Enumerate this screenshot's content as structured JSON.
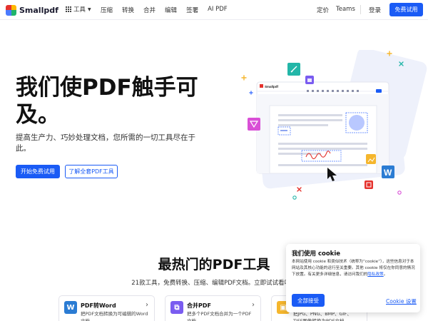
{
  "nav": {
    "brand": "Smallpdf",
    "tools_label": "工具",
    "links": [
      "压缩",
      "转换",
      "合并",
      "编辑",
      "签署",
      "AI PDF"
    ],
    "pricing": "定价",
    "teams": "Teams",
    "login": "登录",
    "cta": "免费试用"
  },
  "hero": {
    "title": "我们使PDF触手可及。",
    "subtitle": "提高生产力、巧妙处理文档，您所需的一切工具尽在于此。",
    "primary_button": "开始免费试用",
    "secondary_button": "了解全套PDF工具",
    "illustration": {
      "window_brand": "Smallpdf",
      "accent_color": "#4a7aff"
    }
  },
  "section": {
    "title": "最热门的PDF工具",
    "subtitle": "21款工具，免费转换、压缩、编辑PDF文档。立即试试看吧！",
    "cards": [
      {
        "icon": "word-icon",
        "icon_text": "W",
        "color": "#2b7cd3",
        "title": "PDF转Word",
        "desc": "把PDF文档转换为可编辑的Word文档"
      },
      {
        "icon": "merge-icon",
        "icon_text": "⧉",
        "color": "#7a5cf0",
        "title": "合并PDF",
        "desc": "把多个PDF文档合并为一个PDF文档"
      },
      {
        "icon": "image-icon",
        "icon_text": "▣",
        "color": "#f5b62d",
        "title": "",
        "desc": "把JPG、PNG、BMP、GIF、TIFF图像转换为PDF文档"
      }
    ]
  },
  "cookie": {
    "title": "我们使用 cookie",
    "text": "本网站使用 cookie 和类似技术（统称为“cookie”），这些信息对于本网站及其核心功能的运行至关重要。其他 cookie 将仅在你同意的情况下放置。有关更多详细信息，请访问我们的",
    "link": "隐私政策",
    "text_end": "。",
    "accept": "全部接受",
    "settings": "Cookie 设置"
  }
}
